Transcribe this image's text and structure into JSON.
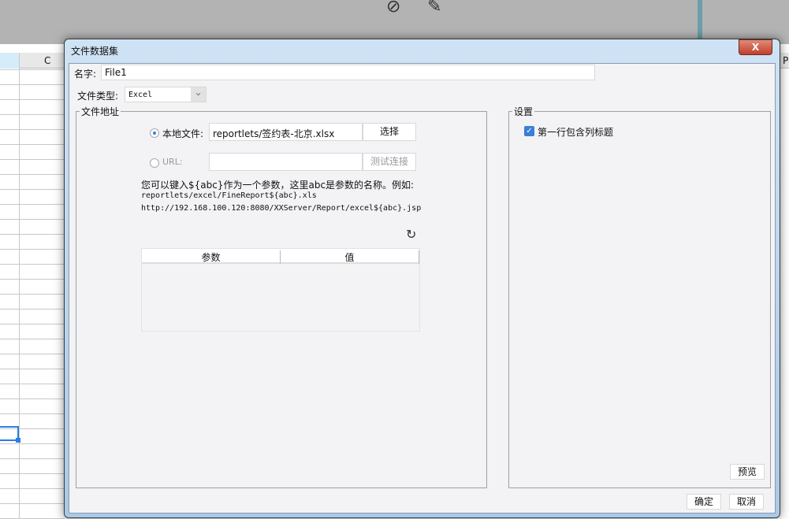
{
  "background": {
    "column_header": "C",
    "right_column_header": "P",
    "toolbar_icons": [
      "eye-slash-icon",
      "pencil-icon"
    ]
  },
  "dialog": {
    "title": "文件数据集",
    "close_label": "X",
    "name_label": "名字:",
    "name_value": "File1",
    "file_type_label": "文件类型:",
    "file_type_value": "Excel",
    "address_group": "文件地址",
    "local_file_label": "本地文件:",
    "local_file_value": "reportlets/签约表-北京.xlsx",
    "local_file_selected": true,
    "choose_button": "选择",
    "url_label": "URL:",
    "url_value": "",
    "test_button": "测试连接",
    "hint_line1": "您可以键入${abc}作为一个参数，这里abc是参数的名称。例如:",
    "hint_line2": "reportlets/excel/FineReport${abc}.xls",
    "hint_line3": "http://192.168.100.120:8080/XXServer/Report/excel${abc}.jsp",
    "param_table": {
      "columns": [
        "参数",
        "值"
      ],
      "rows": []
    },
    "settings_group": "设置",
    "first_row_header_label": "第一行包含列标题",
    "first_row_header_checked": true,
    "preview_button": "预览",
    "ok_button": "确定",
    "cancel_button": "取消"
  }
}
